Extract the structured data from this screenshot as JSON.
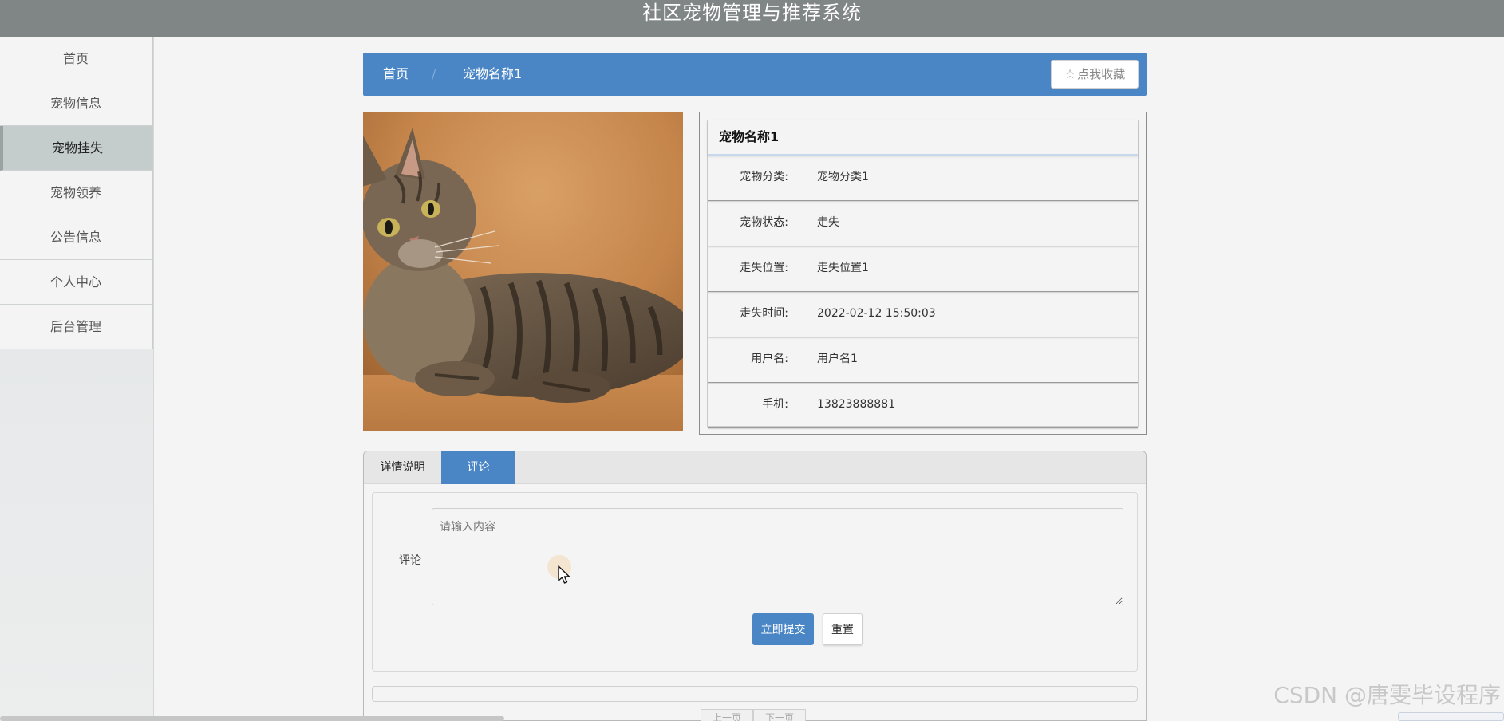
{
  "header": {
    "title": "社区宠物管理与推荐系统"
  },
  "sidebar": {
    "items": [
      {
        "label": "首页"
      },
      {
        "label": "宠物信息"
      },
      {
        "label": "宠物挂失"
      },
      {
        "label": "宠物领养"
      },
      {
        "label": "公告信息"
      },
      {
        "label": "个人中心"
      },
      {
        "label": "后台管理"
      }
    ],
    "active_index": 2
  },
  "breadcrumb": {
    "home": "首页",
    "separator": "/",
    "current": "宠物名称1",
    "favorite_label": "点我收藏",
    "favorite_icon": "star-outline-icon"
  },
  "pet": {
    "image_alt": "tabby cat lying on orange background",
    "name": "宠物名称1",
    "fields": [
      {
        "label": "宠物分类:",
        "value": "宠物分类1"
      },
      {
        "label": "宠物状态:",
        "value": "走失"
      },
      {
        "label": "走失位置:",
        "value": "走失位置1"
      },
      {
        "label": "走失时间:",
        "value": "2022-02-12 15:50:03"
      },
      {
        "label": "用户名:",
        "value": "用户名1"
      },
      {
        "label": "手机:",
        "value": "13823888881"
      }
    ]
  },
  "tabs": {
    "items": [
      {
        "label": "详情说明"
      },
      {
        "label": "评论"
      }
    ],
    "active_index": 1
  },
  "comment_form": {
    "label": "评论",
    "placeholder": "请输入内容",
    "value": "",
    "submit_label": "立即提交",
    "reset_label": "重置"
  },
  "pager": {
    "prev_label": "上一页",
    "next_label": "下一页"
  },
  "watermark": "CSDN @唐雯毕设程序",
  "colors": {
    "accent": "#4a86c6",
    "topbar": "#808585",
    "sidebar_active": "#c4cdcb"
  }
}
